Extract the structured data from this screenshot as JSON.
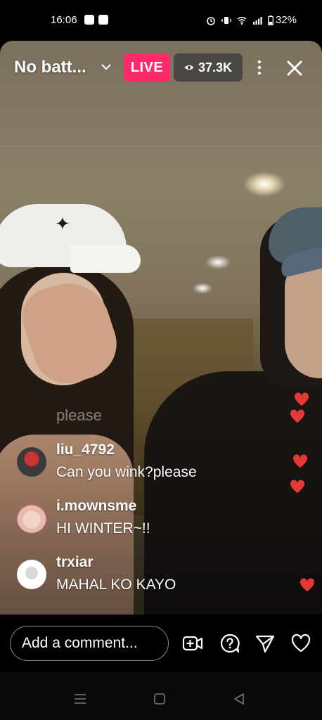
{
  "status_bar": {
    "time": "16:06",
    "battery": "32%",
    "app_icons": [
      "music-icon",
      "youtube-icon"
    ],
    "right_icons": [
      "alarm-icon",
      "vibrate-icon",
      "wifi-icon",
      "signal-icon",
      "battery-icon"
    ]
  },
  "header": {
    "title": "No batt...",
    "live_label": "LIVE",
    "live_color": "#ff2a6a",
    "viewer_count": "37.3K"
  },
  "ghost_comment": "please",
  "comments": [
    {
      "user": "liu_4792",
      "message": "Can you wink?please"
    },
    {
      "user": "i.mownsme",
      "message": "HI WINTER~!!"
    },
    {
      "user": "trxiar",
      "message": "MAHAL KO KAYO"
    }
  ],
  "heart_color": "#e53935",
  "comment_input": {
    "placeholder": "Add a comment..."
  },
  "actions": [
    "add-video-icon",
    "question-icon",
    "send-icon",
    "heart-icon"
  ],
  "nav": [
    "recents-icon",
    "home-icon",
    "back-icon"
  ]
}
